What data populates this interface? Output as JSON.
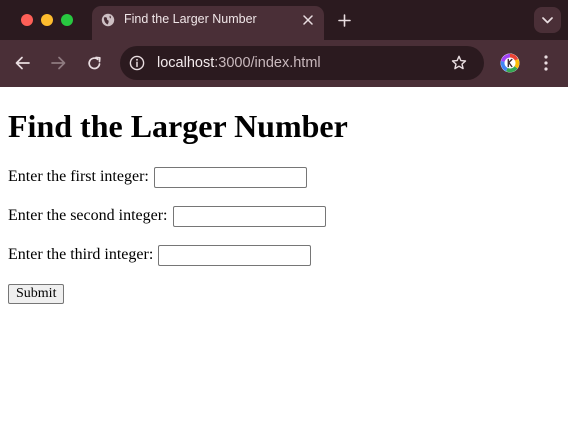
{
  "browser": {
    "tab_title": "Find the Larger Number",
    "url_host": "localhost",
    "url_path": ":3000/index.html"
  },
  "icons": {
    "tab_favicon": "globe-icon",
    "tab_close": "close-icon",
    "new_tab": "plus-icon",
    "tab_search": "chevron-down-icon",
    "back": "arrow-left-icon",
    "forward": "arrow-right-icon",
    "reload": "reload-icon",
    "site_info": "info-icon",
    "bookmark": "star-icon",
    "profile": "profile-avatar-icon",
    "menu": "kebab-menu-icon"
  },
  "colors": {
    "tabstrip_bg": "#2b1a1f",
    "toolbar_bg": "#4a2f37",
    "page_bg": "#ffffff"
  },
  "page": {
    "heading": "Find the Larger Number",
    "fields": [
      {
        "label": "Enter the first integer:",
        "value": ""
      },
      {
        "label": "Enter the second integer:",
        "value": ""
      },
      {
        "label": "Enter the third integer:",
        "value": ""
      }
    ],
    "submit_label": "Submit"
  }
}
